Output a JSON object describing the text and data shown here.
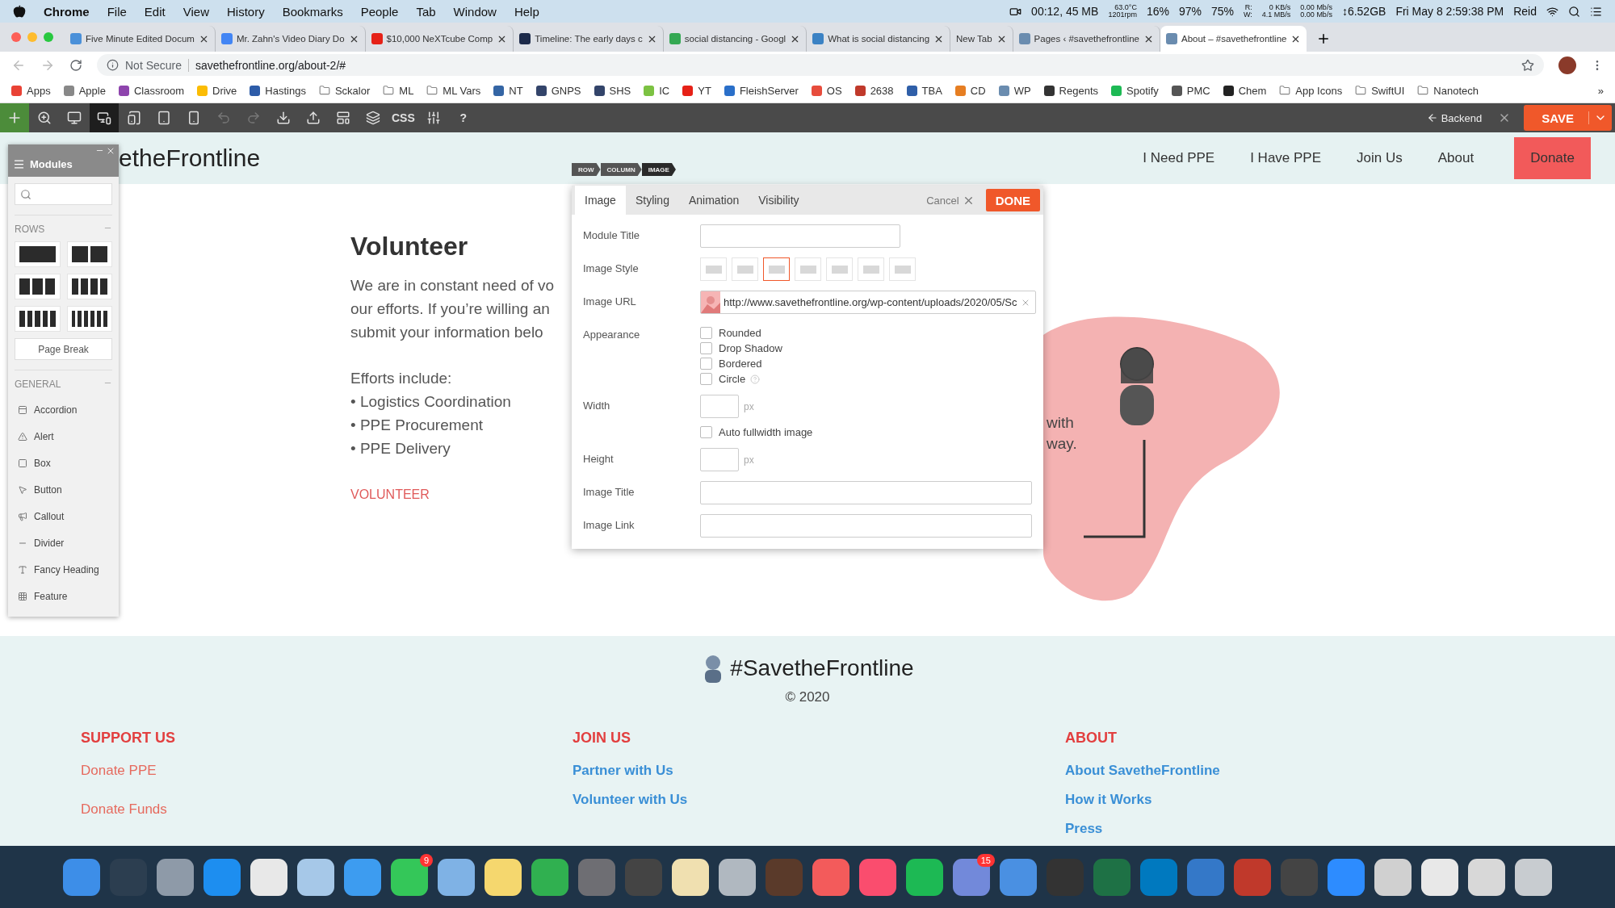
{
  "menu_bar": {
    "app": "Chrome",
    "items": [
      "File",
      "Edit",
      "View",
      "History",
      "Bookmarks",
      "People",
      "Tab",
      "Window",
      "Help"
    ],
    "status": [
      {
        "lines": [
          "00:12, 45 MB"
        ]
      },
      {
        "lines": [
          "63.0°C",
          "1201rpm"
        ]
      },
      {
        "lines": [
          "16%"
        ]
      },
      {
        "lines": [
          "97%"
        ]
      },
      {
        "lines": [
          "75%"
        ]
      },
      {
        "lines": [
          "R:",
          "W:"
        ]
      },
      {
        "lines": [
          "0 KB/s",
          "4.1 MB/s"
        ]
      },
      {
        "lines": [
          "0.00 Mb/s",
          "0.00 Mb/s"
        ]
      },
      {
        "lines": [
          "↕6.52GB"
        ]
      },
      {
        "lines": [
          "Fri May 8  2:59:38 PM"
        ]
      },
      {
        "lines": [
          "Reid"
        ]
      }
    ]
  },
  "browser_tabs": [
    {
      "title": "Five Minute Edited Docum",
      "selected": false,
      "color": "#4a90d9"
    },
    {
      "title": "Mr. Zahn's Video Diary Do",
      "selected": false,
      "color": "#4285f4"
    },
    {
      "title": "$10,000 NeXTcube Comp",
      "selected": false,
      "color": "#e62117"
    },
    {
      "title": "Timeline: The early days c",
      "selected": false,
      "color": "#1c2a4a"
    },
    {
      "title": "social distancing - Googl",
      "selected": false,
      "color": "#34a853"
    },
    {
      "title": "What is social distancing",
      "selected": false,
      "color": "#3b82c4"
    },
    {
      "title": "New Tab",
      "selected": false
    },
    {
      "title": "Pages ‹ #savethefrontline",
      "selected": false,
      "color": "#6a8caf"
    },
    {
      "title": "About – #savethefrontline",
      "selected": true,
      "color": "#6a8caf"
    }
  ],
  "address_bar": {
    "security": "Not Secure",
    "url": "savethefrontline.org/about-2/#"
  },
  "bookmarks": [
    {
      "label": "Apps",
      "kind": "site",
      "color": "#e94235"
    },
    {
      "label": "Apple",
      "kind": "site",
      "color": "#888888"
    },
    {
      "label": "Classroom",
      "kind": "site",
      "color": "#8e44ad"
    },
    {
      "label": "Drive",
      "kind": "site",
      "color": "#fbbc04"
    },
    {
      "label": "Hastings",
      "kind": "site",
      "color": "#2d5ca8"
    },
    {
      "label": "Sckalor",
      "kind": "folder"
    },
    {
      "label": "ML",
      "kind": "folder"
    },
    {
      "label": "ML Vars",
      "kind": "folder"
    },
    {
      "label": "NT",
      "kind": "site",
      "color": "#3465a4"
    },
    {
      "label": "GNPS",
      "kind": "site",
      "color": "#33446a"
    },
    {
      "label": "SHS",
      "kind": "site",
      "color": "#33446a"
    },
    {
      "label": "IC",
      "kind": "site",
      "color": "#7cc242"
    },
    {
      "label": "YT",
      "kind": "site",
      "color": "#e62117"
    },
    {
      "label": "FleishServer",
      "kind": "site",
      "color": "#2a6fc9"
    },
    {
      "label": "OS",
      "kind": "site",
      "color": "#e74c3c"
    },
    {
      "label": "2638",
      "kind": "site",
      "color": "#c0392b"
    },
    {
      "label": "TBA",
      "kind": "site",
      "color": "#2f5fa8"
    },
    {
      "label": "CD",
      "kind": "site",
      "color": "#e67e22"
    },
    {
      "label": "WP",
      "kind": "site",
      "color": "#6a8caf"
    },
    {
      "label": "Regents",
      "kind": "site",
      "color": "#333333"
    },
    {
      "label": "Spotify",
      "kind": "site",
      "color": "#1db954"
    },
    {
      "label": "PMC",
      "kind": "site",
      "color": "#555555"
    },
    {
      "label": "Chem",
      "kind": "site",
      "color": "#222222"
    },
    {
      "label": "App Icons",
      "kind": "folder"
    },
    {
      "label": "SwiftUI",
      "kind": "folder"
    },
    {
      "label": "Nanotech",
      "kind": "folder"
    }
  ],
  "bookmarks_more": "»",
  "builder_toolbar": {
    "tools": [
      {
        "kind": "icon",
        "selected": false,
        "disabled": false
      },
      {
        "kind": "icon",
        "selected": false,
        "disabled": false
      },
      {
        "kind": "icon",
        "selected": true,
        "disabled": false
      },
      {
        "kind": "icon",
        "selected": false,
        "disabled": false
      },
      {
        "kind": "icon",
        "selected": false,
        "disabled": false
      },
      {
        "kind": "icon",
        "selected": false,
        "disabled": false
      },
      {
        "kind": "icon",
        "selected": false,
        "disabled": true
      },
      {
        "kind": "icon",
        "selected": false,
        "disabled": true
      },
      {
        "kind": "icon",
        "selected": false,
        "disabled": false
      },
      {
        "kind": "icon",
        "selected": false,
        "disabled": false
      },
      {
        "kind": "icon",
        "selected": false,
        "disabled": false
      },
      {
        "kind": "icon",
        "selected": false,
        "disabled": false
      },
      {
        "kind": "text",
        "label": "CSS"
      },
      {
        "kind": "icon",
        "selected": false,
        "disabled": false
      },
      {
        "kind": "text",
        "label": "?"
      }
    ],
    "backend": "Backend",
    "save": "SAVE"
  },
  "site": {
    "logo": "etheFrontline",
    "nav": [
      {
        "label": "I Need PPE",
        "kind": "link"
      },
      {
        "label": "I Have PPE",
        "kind": "link"
      },
      {
        "label": "Join Us",
        "kind": "link"
      },
      {
        "label": "About",
        "kind": "link"
      },
      {
        "label": "Donate",
        "kind": "button"
      }
    ],
    "heading": "Volunteer",
    "paragraph": [
      "We are in constant need of vo",
      "our efforts. If you’re willing an",
      "submit your information belo"
    ],
    "efforts_title": "Efforts include:",
    "efforts": [
      "• Logistics Coordination",
      "• PPE Procurement",
      "• PPE Delivery"
    ],
    "cta": "VOLUNTEER",
    "illustration_text": [
      "with",
      "way."
    ]
  },
  "modules_panel": {
    "title": "Modules",
    "rows_label": "ROWS",
    "page_break": "Page Break",
    "general_label": "GENERAL",
    "modules": [
      "Accordion",
      "Alert",
      "Box",
      "Button",
      "Callout",
      "Divider",
      "Fancy Heading",
      "Feature"
    ]
  },
  "dialog": {
    "breadcrumb": [
      "ROW",
      "COLUMN",
      "IMAGE"
    ],
    "tabs": [
      {
        "label": "Image",
        "selected": true
      },
      {
        "label": "Styling",
        "selected": false
      },
      {
        "label": "Animation",
        "selected": false
      },
      {
        "label": "Visibility",
        "selected": false
      }
    ],
    "cancel": "Cancel",
    "done": "DONE",
    "module_title_label": "Module Title",
    "image_style_label": "Image Style",
    "image_styles": [
      {
        "selected": false
      },
      {
        "selected": false
      },
      {
        "selected": true
      },
      {
        "selected": false
      },
      {
        "selected": false
      },
      {
        "selected": false
      },
      {
        "selected": false
      }
    ],
    "image_url_label": "Image URL",
    "image_url": "http://www.savethefrontline.org/wp-content/uploads/2020/05/Sc",
    "appearance_label": "Appearance",
    "appearance": [
      {
        "label": "Rounded",
        "checked": false
      },
      {
        "label": "Drop Shadow",
        "checked": false
      },
      {
        "label": "Bordered",
        "checked": false
      },
      {
        "label": "Circle",
        "checked": false
      }
    ],
    "width_label": "Width",
    "width_unit": "px",
    "auto_fullwidth": {
      "label": "Auto fullwidth image",
      "checked": false
    },
    "height_label": "Height",
    "height_unit": "px",
    "image_title_label": "Image Title",
    "image_link_label": "Image Link"
  },
  "footer": {
    "brand": "#SavetheFrontline",
    "copyright": "© 2020",
    "columns": [
      {
        "title": "SUPPORT US",
        "kind": "plain",
        "links": [
          "Donate PPE",
          "Donate Funds"
        ]
      },
      {
        "title": "JOIN US",
        "kind": "bold",
        "links": [
          "Partner with Us",
          "Volunteer with Us"
        ]
      },
      {
        "title": "ABOUT",
        "kind": "bold",
        "links": [
          "About SavetheFrontline",
          "How it Works",
          "Press"
        ]
      }
    ]
  },
  "dock": [
    {
      "color": "#3d8ee8"
    },
    {
      "color": "#2c3e50"
    },
    {
      "color": "#8e9aa8"
    },
    {
      "color": "#1d8ef0"
    },
    {
      "color": "#e8e8e8"
    },
    {
      "color": "#a6c8e8"
    },
    {
      "color": "#3d9cf0"
    },
    {
      "color": "#34c759",
      "badge": "9"
    },
    {
      "color": "#7fb2e5"
    },
    {
      "color": "#f5d76e"
    },
    {
      "color": "#30b050"
    },
    {
      "color": "#6e6e73"
    },
    {
      "color": "#444444"
    },
    {
      "color": "#f0e0b0"
    },
    {
      "color": "#b0b8c0"
    },
    {
      "color": "#5a3a2a"
    },
    {
      "color": "#f35b5b"
    },
    {
      "color": "#fa4d6e"
    },
    {
      "color": "#1db954"
    },
    {
      "color": "#7289da",
      "badge": "15"
    },
    {
      "color": "#4a90e2"
    },
    {
      "color": "#333333"
    },
    {
      "color": "#1e7145"
    },
    {
      "color": "#0079bf"
    },
    {
      "color": "#3478c8"
    },
    {
      "color": "#c0392b"
    },
    {
      "color": "#444444"
    },
    {
      "color": "#2d8cff"
    },
    {
      "color": "#d0d0d0"
    },
    {
      "color": "#e8e8e8"
    },
    {
      "color": "#d8d8d8"
    },
    {
      "color": "#c8ccd0"
    }
  ]
}
